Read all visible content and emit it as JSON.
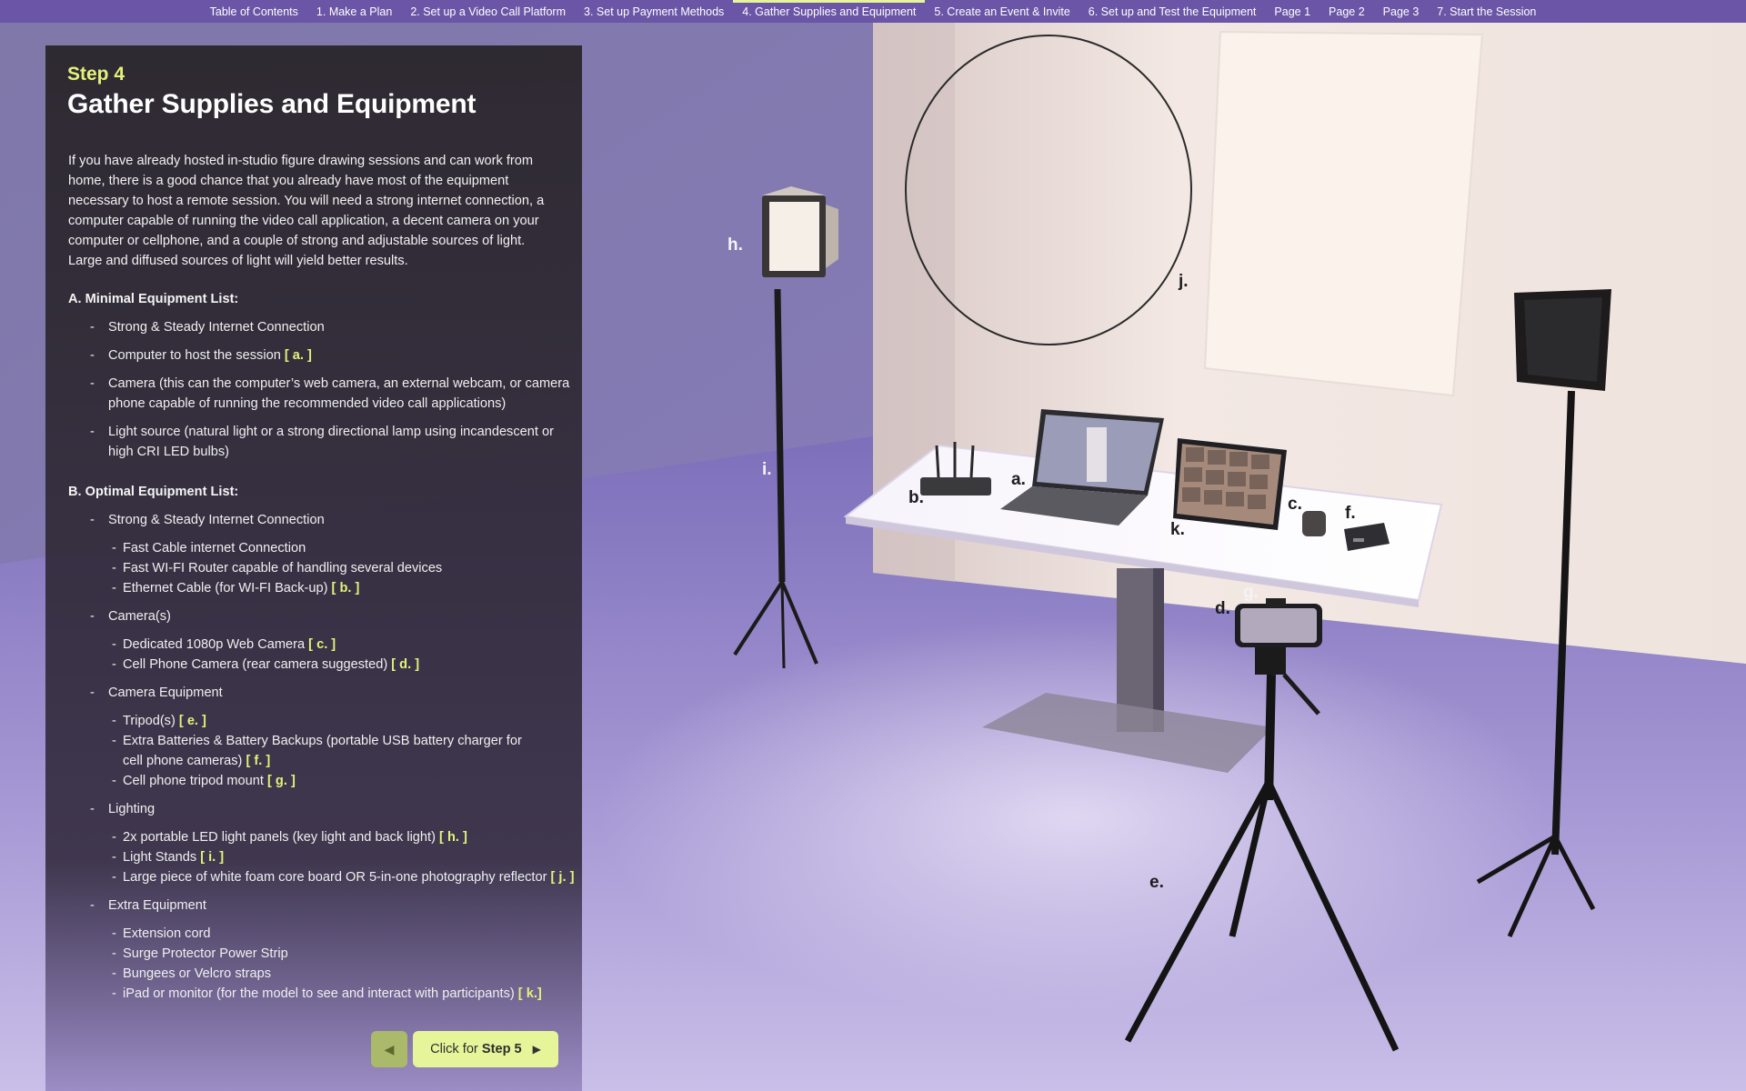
{
  "nav": {
    "tabs": [
      {
        "label": "Table of Contents"
      },
      {
        "label": "1. Make a Plan"
      },
      {
        "label": "2. Set up a Video Call Platform"
      },
      {
        "label": "3. Set up Payment Methods"
      },
      {
        "label": "4. Gather Supplies and Equipment",
        "active": true
      },
      {
        "label": "5. Create an Event & Invite"
      },
      {
        "label": "6. Set up and Test the Equipment"
      },
      {
        "label": "Page 1"
      },
      {
        "label": "Page 2"
      },
      {
        "label": "Page 3"
      },
      {
        "label": "7. Start the Session"
      }
    ]
  },
  "panel": {
    "kicker": "Step 4",
    "title": "Gather Supplies and Equipment",
    "intro": "If you have already hosted in-studio figure drawing sessions and can work from home, there is a good chance that you already have most of the equipment necessary to host a remote session. You will need a strong internet connection, a computer capable of running the video call application, a decent camera on your computer or cellphone, and a couple of strong and adjustable sources of light. Large and diffused sources of light will yield better results.",
    "minimal": {
      "heading": "A. Minimal Equipment List:",
      "items": [
        {
          "text": "Strong & Steady Internet Connection",
          "ref": ""
        },
        {
          "text": "Computer to host the session",
          "ref": "[ a. ]"
        },
        {
          "text": "Camera (this can the computer’s web camera, an external webcam, or camera phone capable of running the recommended video call applications)",
          "ref": ""
        },
        {
          "text": "Light source (natural light or a strong directional lamp using incandescent or high CRI LED bulbs)",
          "ref": ""
        }
      ]
    },
    "optimal": {
      "heading": "B. Optimal Equipment List:",
      "groups": [
        {
          "label": "Strong & Steady Internet Connection",
          "items": [
            {
              "text": "Fast Cable internet Connection",
              "ref": ""
            },
            {
              "text": "Fast WI-FI Router capable of handling several devices",
              "ref": ""
            },
            {
              "text": "Ethernet Cable (for WI-FI Back-up)",
              "ref": "[ b. ]"
            }
          ]
        },
        {
          "label": "Camera(s)",
          "items": [
            {
              "text": "Dedicated 1080p Web Camera",
              "ref": "[ c. ]"
            },
            {
              "text": "Cell Phone Camera (rear camera suggested)",
              "ref": "[ d. ]"
            }
          ]
        },
        {
          "label": "Camera Equipment",
          "items": [
            {
              "text": "Tripod(s)",
              "ref": "[ e. ]"
            },
            {
              "text": "Extra Batteries & Battery Backups (portable USB battery charger for cell phone cameras)",
              "ref": "[ f. ]"
            },
            {
              "text": "Cell phone tripod mount",
              "ref": "[ g. ]"
            }
          ]
        },
        {
          "label": "Lighting",
          "items": [
            {
              "text": "2x portable LED light panels (key light and back light)",
              "ref": "[ h. ]"
            },
            {
              "text": "Light Stands",
              "ref": "[ i. ]"
            },
            {
              "text": "Large piece of white foam core board OR 5-in-one photography reflector",
              "ref": "[ j. ]"
            }
          ]
        },
        {
          "label": "Extra Equipment",
          "items": [
            {
              "text": "Extension cord",
              "ref": ""
            },
            {
              "text": "Surge Protector Power Strip",
              "ref": ""
            },
            {
              "text": "Bungees or Velcro straps",
              "ref": ""
            },
            {
              "text": "iPad or monitor (for the model to see and interact with participants)",
              "ref": "[ k.]"
            }
          ]
        }
      ]
    },
    "prev_icon": "◀",
    "next": {
      "prefix": "Click for",
      "bold": "Step 5",
      "icon": "▶"
    }
  },
  "scene_labels": {
    "a": "a.",
    "b": "b.",
    "c": "c.",
    "d": "d.",
    "e": "e.",
    "f": "f.",
    "g": "g.",
    "h": "h.",
    "i": "i.",
    "j": "j.",
    "k": "k."
  },
  "colors": {
    "nav_bg": "#6a55a6",
    "accent": "#e3f27a",
    "button": "#e6f59a",
    "floor": "#8e7ec4",
    "wall": "#eadbd6"
  }
}
